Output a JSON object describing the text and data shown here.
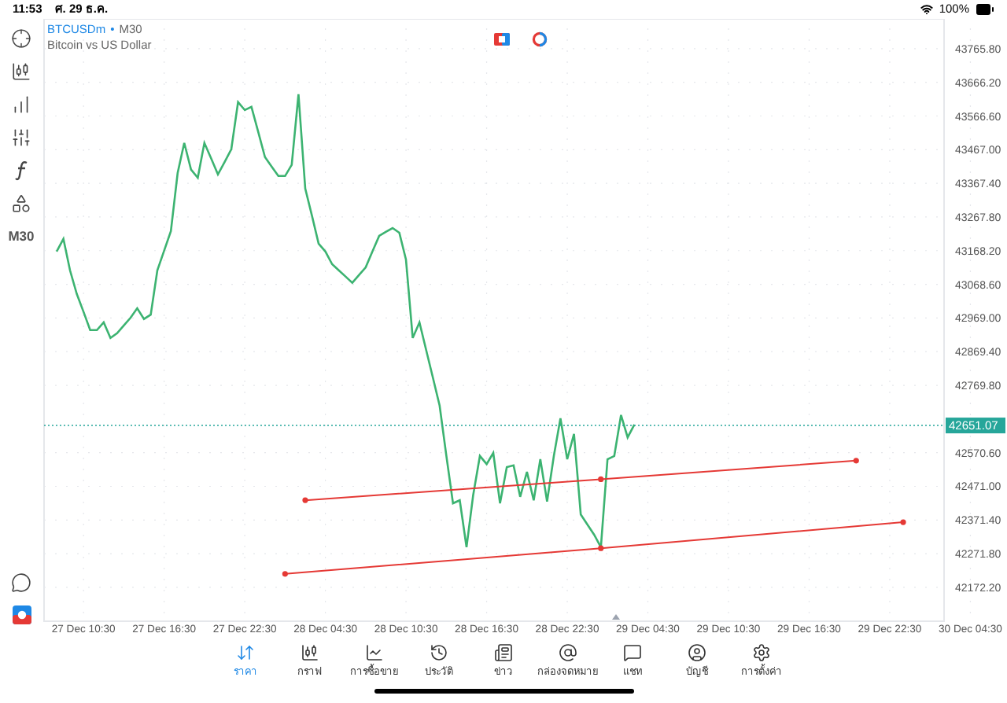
{
  "status_bar": {
    "time": "11:53",
    "date": "ศ. 29 ธ.ค.",
    "battery": "100%"
  },
  "toolbar": {
    "timeframe": "M30"
  },
  "chart": {
    "symbol": "BTCUSDm",
    "separator": "•",
    "timeframe": "M30",
    "description": "Bitcoin vs US Dollar",
    "chart_data": {
      "type": "line",
      "categories": [
        null,
        null,
        null,
        null,
        "27 Dec 10:30",
        null,
        null,
        null,
        null,
        null,
        null,
        null,
        null,
        null,
        null,
        null,
        "27 Dec 16:30",
        null,
        null,
        null,
        null,
        null,
        null,
        null,
        null,
        null,
        null,
        null,
        "27 Dec 22:30",
        null,
        null,
        null,
        null,
        null,
        null,
        null,
        null,
        null,
        null,
        null,
        "28 Dec 04:30",
        null,
        null,
        null,
        null,
        null,
        null,
        null,
        null,
        null,
        null,
        null,
        "28 Dec 10:30",
        null,
        null,
        null,
        null,
        null,
        null,
        null,
        null,
        null,
        null,
        null,
        "28 Dec 16:30",
        null,
        null,
        null,
        null,
        null,
        null,
        null,
        null,
        null,
        null,
        null,
        "28 Dec 22:30",
        null,
        null,
        null,
        null,
        null,
        null,
        null,
        null,
        null,
        null,
        null,
        "29 Dec 04:30",
        null,
        null,
        null,
        null,
        null,
        null,
        null,
        null,
        null,
        null,
        null,
        "29 Dec 10:30",
        null,
        null,
        null,
        null,
        null,
        null,
        null,
        null,
        null,
        null,
        null,
        "29 Dec 16:30",
        null,
        null,
        null,
        null,
        null,
        null,
        null,
        null,
        null,
        null,
        null,
        "29 Dec 22:30",
        null,
        null,
        null,
        null,
        null,
        null,
        null,
        null,
        null,
        null,
        null,
        "30 Dec 04:30"
      ],
      "series": [
        {
          "color": "#3cb371",
          "values": [
            43166,
            43203,
            43110,
            43040,
            42987,
            42933,
            42933,
            42956,
            42910,
            42924,
            42947,
            42970,
            42998,
            42966,
            42979,
            43110,
            43168,
            43226,
            43398,
            43487,
            43408,
            43384,
            43487,
            43441,
            43394,
            43431,
            43468,
            43608,
            43584,
            43594,
            43520,
            43445,
            43417,
            43389,
            43389,
            43422,
            43631,
            43352,
            43271,
            43189,
            43166,
            43128,
            43110,
            43092,
            43073,
            43096,
            43119,
            43166,
            43212,
            43224,
            43235,
            43221,
            43142,
            42910,
            42956,
            42875,
            42793,
            42710,
            42561,
            42421,
            42430,
            42291,
            42444,
            42561,
            42537,
            42570,
            42421,
            42528,
            42533,
            42440,
            42514,
            42430,
            42551,
            42426,
            42561,
            42672,
            42551,
            42626,
            42388,
            42358,
            42328,
            42291,
            42551,
            42561,
            42682,
            42616,
            42654,
            null,
            null,
            null,
            null,
            null,
            null,
            null,
            null,
            null,
            null,
            null,
            null,
            null,
            null,
            null,
            null,
            null,
            null,
            null,
            null,
            null,
            null,
            null,
            null,
            null,
            null,
            null,
            null,
            null,
            null,
            null,
            null,
            null,
            null,
            null,
            null,
            null,
            null,
            null,
            null,
            null,
            null,
            null,
            null,
            null,
            null,
            null,
            null,
            null,
            null
          ]
        },
        {
          "color": "#e53935",
          "marker": "circle",
          "values": [
            null,
            null,
            null,
            null,
            null,
            null,
            null,
            null,
            null,
            null,
            null,
            null,
            null,
            null,
            null,
            null,
            null,
            null,
            null,
            null,
            null,
            null,
            null,
            null,
            null,
            null,
            null,
            null,
            null,
            null,
            null,
            null,
            null,
            null,
            null,
            null,
            null,
            42430,
            null,
            null,
            null,
            null,
            null,
            null,
            null,
            null,
            null,
            null,
            null,
            null,
            null,
            null,
            null,
            null,
            null,
            null,
            null,
            null,
            null,
            null,
            null,
            null,
            null,
            null,
            null,
            null,
            null,
            null,
            null,
            null,
            null,
            null,
            null,
            null,
            null,
            null,
            null,
            null,
            null,
            null,
            null,
            42492,
            null,
            null,
            null,
            null,
            null,
            null,
            null,
            null,
            null,
            null,
            null,
            null,
            null,
            null,
            null,
            null,
            null,
            null,
            null,
            null,
            null,
            null,
            null,
            null,
            null,
            null,
            null,
            null,
            null,
            null,
            null,
            null,
            null,
            null,
            null,
            null,
            null,
            42547,
            null,
            null,
            null,
            null,
            null,
            null,
            null,
            null,
            null,
            null,
            null,
            null,
            null,
            null,
            null,
            null,
            null
          ]
        },
        {
          "color": "#e53935",
          "marker": "circle",
          "values": [
            null,
            null,
            null,
            null,
            null,
            null,
            null,
            null,
            null,
            null,
            null,
            null,
            null,
            null,
            null,
            null,
            null,
            null,
            null,
            null,
            null,
            null,
            null,
            null,
            null,
            null,
            null,
            null,
            null,
            null,
            null,
            null,
            null,
            null,
            42212,
            null,
            null,
            null,
            null,
            null,
            null,
            null,
            null,
            null,
            null,
            null,
            null,
            null,
            null,
            null,
            null,
            null,
            null,
            null,
            null,
            null,
            null,
            null,
            null,
            null,
            null,
            null,
            null,
            null,
            null,
            null,
            null,
            null,
            null,
            null,
            null,
            null,
            null,
            null,
            null,
            null,
            null,
            null,
            null,
            null,
            null,
            42288,
            null,
            null,
            null,
            null,
            null,
            null,
            null,
            null,
            null,
            null,
            null,
            null,
            null,
            null,
            null,
            null,
            null,
            null,
            null,
            null,
            null,
            null,
            null,
            null,
            null,
            null,
            null,
            null,
            null,
            null,
            null,
            null,
            null,
            null,
            null,
            null,
            null,
            null,
            null,
            null,
            null,
            null,
            null,
            null,
            42365,
            null,
            null,
            null,
            null,
            null,
            null,
            null,
            null,
            null,
            null
          ]
        }
      ],
      "grid": true,
      "ylim": [
        42072,
        43826
      ],
      "yticks": [
        {
          "value": 43765.8,
          "label": "43765.80"
        },
        {
          "value": 43666.2,
          "label": "43666.20"
        },
        {
          "value": 43566.6,
          "label": "43566.60"
        },
        {
          "value": 43467,
          "label": "43467.00"
        },
        {
          "value": 43367.4,
          "label": "43367.40"
        },
        {
          "value": 43267.8,
          "label": "43267.80"
        },
        {
          "value": 43168.2,
          "label": "43168.20"
        },
        {
          "value": 43068.6,
          "label": "43068.60"
        },
        {
          "value": 42969,
          "label": "42969.00"
        },
        {
          "value": 42869.4,
          "label": "42869.40"
        },
        {
          "value": 42769.8,
          "label": "42769.80"
        },
        {
          "value": 42570.6,
          "label": "42570.60"
        },
        {
          "value": 42471,
          "label": "42471.00"
        },
        {
          "value": 42371.4,
          "label": "42371.40"
        },
        {
          "value": 42271.8,
          "label": "42271.80"
        },
        {
          "value": 42172.2,
          "label": "42172.20"
        }
      ],
      "ref_lines": [
        {
          "axis": "y",
          "value": 42651.07,
          "label": "42651.07",
          "color": "#26a69a"
        }
      ]
    }
  },
  "tabs": [
    {
      "label": "ราคา",
      "selected": true
    },
    {
      "label": "กราฟ",
      "selected": false
    },
    {
      "label": "การซื้อขาย",
      "selected": false
    },
    {
      "label": "ประวัติ",
      "selected": false
    },
    {
      "label": "ข่าว",
      "selected": false
    },
    {
      "label": "กล่องจดหมาย",
      "selected": false
    },
    {
      "label": "แชท",
      "selected": false
    },
    {
      "label": "บัญชี",
      "selected": false
    },
    {
      "label": "การตั้งค่า",
      "selected": false
    }
  ]
}
